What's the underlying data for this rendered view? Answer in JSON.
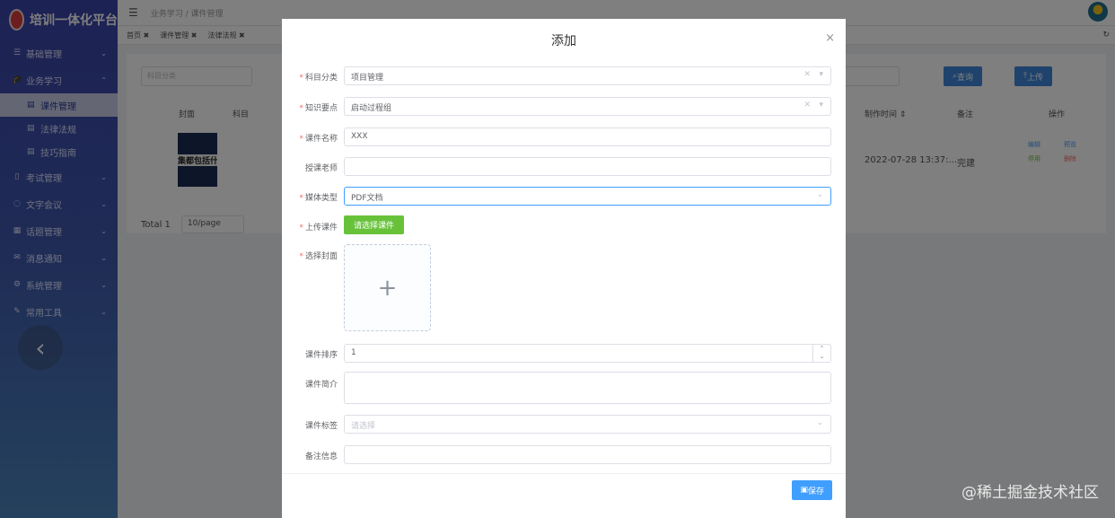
{
  "sidebar": {
    "logo_text": "培训一体化平台",
    "items": [
      {
        "label": "基础管理",
        "icon": "list-icon"
      },
      {
        "label": "业务学习",
        "icon": "cap-icon"
      },
      {
        "label": "课件管理",
        "icon": "doc-icon"
      },
      {
        "label": "法律法规",
        "icon": "doc-icon"
      },
      {
        "label": "技巧指南",
        "icon": "doc-icon"
      },
      {
        "label": "考试管理",
        "icon": "book-icon"
      },
      {
        "label": "文字会议",
        "icon": "chat-icon"
      },
      {
        "label": "话题管理",
        "icon": "grid-icon"
      },
      {
        "label": "消息通知",
        "icon": "mail-icon"
      },
      {
        "label": "系统管理",
        "icon": "gear-icon"
      },
      {
        "label": "常用工具",
        "icon": "wrench-icon"
      }
    ],
    "back_icon": "‹"
  },
  "topbar": {
    "breadcrumb": "业务学习 / 课件管理"
  },
  "tabs": [
    {
      "label": "首页 ✖"
    },
    {
      "label": "课件管理 ✖"
    },
    {
      "label": "法律法规 ✖"
    }
  ],
  "list": {
    "search_placeholder": "科目分类",
    "query_label": "查询",
    "upload_label": "上传",
    "columns": [
      "封面",
      "科目",
      "制作时间 ⇕",
      "备注",
      "操作"
    ],
    "row": {
      "thumb_text": "集都包括什",
      "time": "2022-07-28 13:37:...",
      "remark": "完建",
      "ops": [
        "编辑",
        "预览",
        "停用",
        "删除"
      ]
    },
    "total": "Total 1",
    "page_size": "10/page"
  },
  "dialog": {
    "title": "添加",
    "close_icon": "×",
    "subject_label": "科目分类",
    "subject_value": "项目管理",
    "knowledge_label": "知识要点",
    "knowledge_value": "启动过程组",
    "name_label": "课件名称",
    "name_value": "XXX",
    "teacher_label": "授课老师",
    "teacher_value": "",
    "media_label": "媒体类型",
    "media_value": "PDF文档",
    "upload_label": "上传课件",
    "upload_button": "请选择课件",
    "cover_label": "选择封面",
    "cover_plus": "+",
    "order_label": "课件排序",
    "order_value": "1",
    "intro_label": "课件简介",
    "tag_label": "课件标签",
    "tag_placeholder": "请选择",
    "note_label": "备注信息",
    "save_button": "保存"
  },
  "watermark": "@稀土掘金技术社区",
  "colors": {
    "primary": "#409eff",
    "success": "#67c23a",
    "sidebar": "#3a44a8"
  }
}
